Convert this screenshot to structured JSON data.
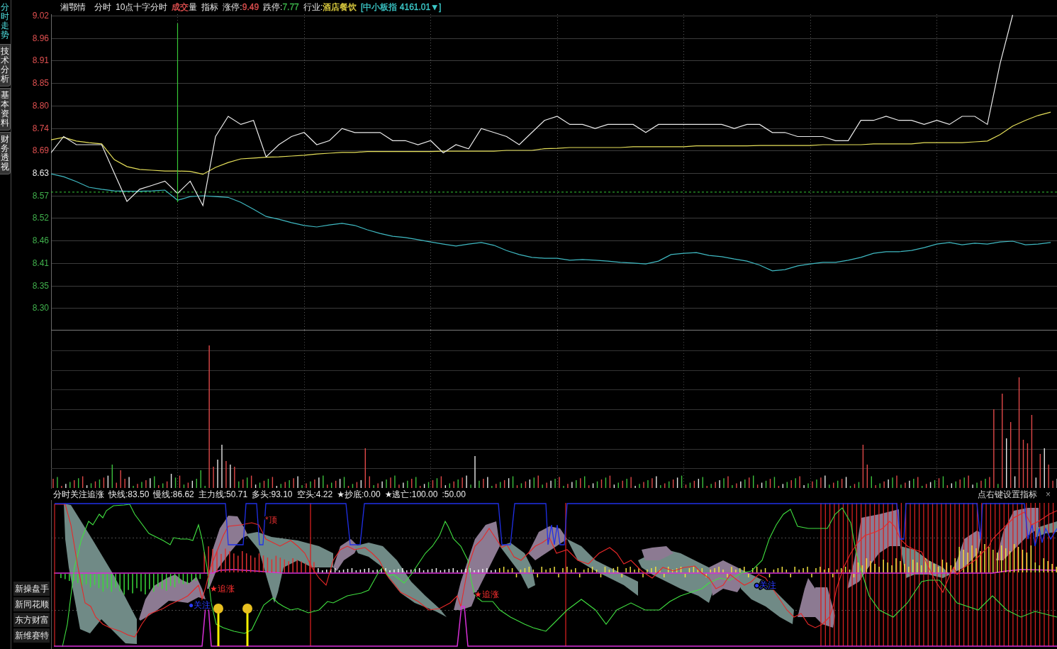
{
  "side_tabs": [
    {
      "label": "分时走势",
      "selected": true
    },
    {
      "label": "技术分析",
      "selected": false
    },
    {
      "label": "基本资料",
      "selected": false
    },
    {
      "label": "财务透视",
      "selected": false
    }
  ],
  "header": {
    "items": [
      {
        "kind": "name",
        "text": "湘鄂情"
      },
      {
        "kind": "mode",
        "text": "分时"
      },
      {
        "kind": "mode",
        "text": "10点十字分时"
      },
      {
        "kind": "toggle",
        "parts": [
          {
            "text": "成交",
            "color": "#e05050"
          },
          {
            "text": "量"
          }
        ]
      },
      {
        "kind": "mode",
        "text": "指标"
      },
      {
        "kind": "field",
        "label": "涨停:",
        "value": "9.49",
        "color": "#e05050"
      },
      {
        "kind": "field",
        "label": "跌停:",
        "value": "7.77",
        "color": "#3cb44a"
      },
      {
        "kind": "field",
        "label": "行业:",
        "value": "酒店餐饮",
        "color": "#e0d040"
      },
      {
        "kind": "index",
        "text": "[中小板指 4161.01▼]"
      }
    ]
  },
  "price_chart": {
    "chart_data": {
      "type": "line",
      "grid": true,
      "categories": [
        null,
        null,
        null,
        null,
        null,
        null,
        null,
        null,
        null,
        null,
        null,
        null,
        null,
        null,
        null,
        null,
        null,
        null,
        null,
        null,
        null,
        null,
        null,
        null,
        null,
        null,
        null,
        null,
        null,
        null,
        null,
        null,
        null,
        null,
        null,
        null,
        null,
        null,
        null,
        null,
        null,
        null,
        null,
        null,
        null,
        null,
        null,
        null,
        null,
        null,
        null,
        null,
        null,
        null,
        null,
        null,
        null,
        null,
        null,
        null,
        null,
        null,
        null,
        null,
        null,
        null,
        null,
        null,
        null,
        null,
        null,
        null,
        null,
        null,
        null,
        null,
        null,
        null,
        null,
        null
      ],
      "ylim": [
        8.2417,
        9.0218
      ],
      "yticks": [
        {
          "value": 8.2972,
          "label": "8.30"
        },
        {
          "value": 8.3527,
          "label": "8.35"
        },
        {
          "value": 8.4081,
          "label": "8.41"
        },
        {
          "value": 8.4636,
          "label": "8.46"
        },
        {
          "value": 8.5191,
          "label": "8.52"
        },
        {
          "value": 8.5745,
          "label": "8.57"
        },
        {
          "value": 8.63,
          "label": "8.63"
        },
        {
          "value": 8.6855,
          "label": "8.69"
        },
        {
          "value": 8.7409,
          "label": "8.74"
        },
        {
          "value": 8.7964,
          "label": "8.80"
        },
        {
          "value": 8.8519,
          "label": "8.85"
        },
        {
          "value": 8.9073,
          "label": "8.91"
        },
        {
          "value": 8.9628,
          "label": "8.96"
        },
        {
          "value": 9.0183,
          "label": "9.02"
        }
      ],
      "series": [
        {
          "color": "#ececec",
          "values": [
            8.68,
            8.72,
            8.7,
            8.7,
            8.7,
            8.63,
            8.56,
            8.59,
            8.6,
            8.61,
            8.58,
            8.61,
            8.55,
            8.72,
            8.77,
            8.75,
            8.76,
            8.67,
            8.7,
            8.72,
            8.73,
            8.7,
            8.71,
            8.74,
            8.73,
            8.73,
            8.73,
            8.71,
            8.71,
            8.7,
            8.71,
            8.68,
            8.7,
            8.69,
            8.74,
            8.73,
            8.72,
            8.7,
            8.73,
            8.76,
            8.77,
            8.75,
            8.75,
            8.74,
            8.75,
            8.75,
            8.75,
            8.73,
            8.75,
            8.75,
            8.75,
            8.75,
            8.75,
            8.75,
            8.74,
            8.75,
            8.75,
            8.73,
            8.73,
            8.72,
            8.72,
            8.72,
            8.71,
            8.71,
            8.76,
            8.76,
            8.77,
            8.76,
            8.76,
            8.75,
            8.76,
            8.75,
            8.77,
            8.77,
            8.75,
            8.9,
            9.02,
            null,
            null,
            null
          ]
        },
        {
          "color": "#e6e05a",
          "values": [
            8.712,
            8.718,
            8.709,
            8.705,
            8.702,
            8.663,
            8.646,
            8.639,
            8.637,
            8.635,
            8.635,
            8.634,
            8.627,
            8.644,
            8.656,
            8.665,
            8.667,
            8.669,
            8.67,
            8.672,
            8.674,
            8.677,
            8.679,
            8.681,
            8.681,
            8.683,
            8.683,
            8.683,
            8.683,
            8.683,
            8.683,
            8.684,
            8.684,
            8.684,
            8.684,
            8.684,
            8.686,
            8.686,
            8.686,
            8.69,
            8.691,
            8.693,
            8.693,
            8.693,
            8.693,
            8.693,
            8.695,
            8.695,
            8.695,
            8.695,
            8.695,
            8.697,
            8.697,
            8.697,
            8.697,
            8.697,
            8.698,
            8.698,
            8.698,
            8.698,
            8.698,
            8.7,
            8.7,
            8.7,
            8.7,
            8.702,
            8.702,
            8.702,
            8.702,
            8.705,
            8.705,
            8.705,
            8.705,
            8.707,
            8.709,
            8.725,
            8.746,
            8.76,
            8.772,
            8.78
          ]
        },
        {
          "color": "#3fb9c2",
          "values": [
            8.628,
            8.621,
            8.609,
            8.595,
            8.59,
            8.586,
            8.585,
            8.585,
            8.586,
            8.588,
            8.563,
            8.572,
            8.574,
            8.572,
            8.57,
            8.558,
            8.541,
            8.523,
            8.516,
            8.508,
            8.501,
            8.497,
            8.502,
            8.506,
            8.501,
            8.49,
            8.481,
            8.474,
            8.471,
            8.466,
            8.46,
            8.455,
            8.45,
            8.455,
            8.459,
            8.452,
            8.439,
            8.429,
            8.422,
            8.42,
            8.42,
            8.415,
            8.417,
            8.415,
            8.413,
            8.41,
            8.408,
            8.406,
            8.413,
            8.429,
            8.432,
            8.434,
            8.427,
            8.424,
            8.418,
            8.413,
            8.403,
            8.389,
            8.392,
            8.401,
            8.406,
            8.41,
            8.41,
            8.415,
            8.422,
            8.432,
            8.436,
            8.436,
            8.439,
            8.446,
            8.455,
            8.459,
            8.453,
            8.457,
            8.455,
            8.46,
            8.462,
            8.453,
            8.455,
            8.459
          ]
        }
      ],
      "ref_lines": [
        {
          "axis": "y",
          "value": 8.583
        }
      ]
    }
  },
  "indicator": {
    "title": "分时关注追涨",
    "readings": [
      "快线:83.50",
      "慢线:86.62",
      "主力线:50.71",
      "多头:93.10",
      "空头:4.22",
      "★抄底:0.00",
      "★逃亡:100.00",
      ":50.00"
    ],
    "hint": "点右键设置指标",
    "close": "×",
    "markers": [
      {
        "kind": "top",
        "text": "*顶"
      },
      {
        "kind": "chase",
        "text": "★追涨"
      },
      {
        "kind": "watch",
        "text": "●关注"
      },
      {
        "kind": "chase",
        "text": "★追涨"
      },
      {
        "kind": "watch",
        "text": "●关注"
      }
    ]
  },
  "shortcuts": [
    "新操盘手",
    "新同花顺",
    "东方财富",
    "新维赛特"
  ]
}
